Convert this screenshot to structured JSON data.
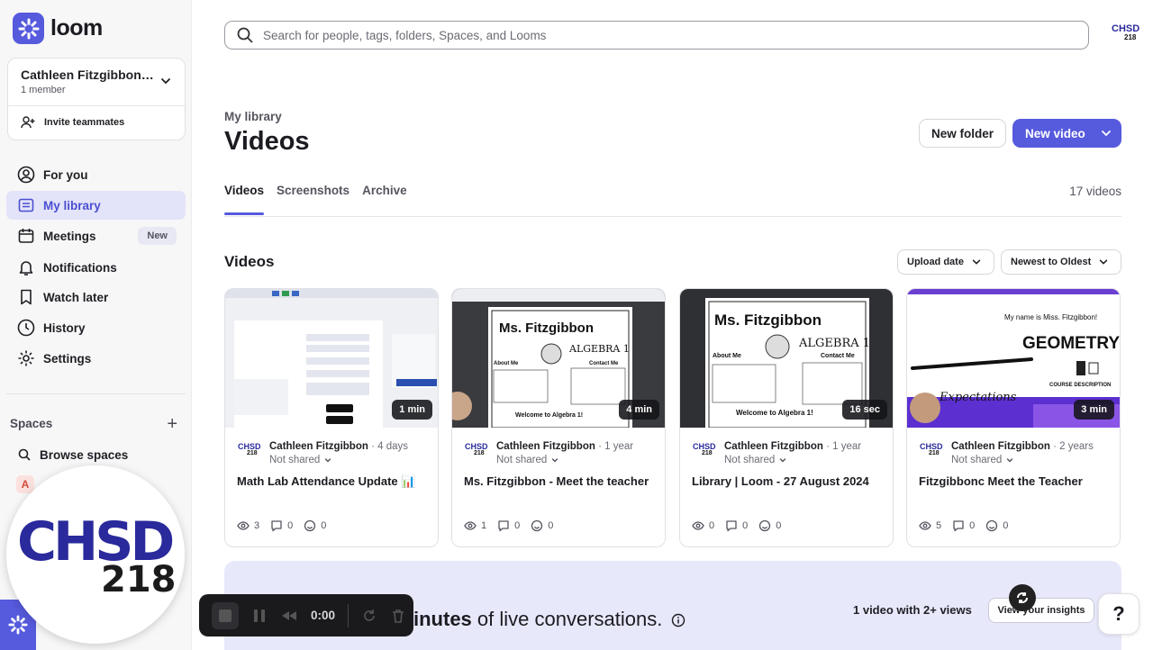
{
  "app": {
    "brand": "loom",
    "accent": "#565add"
  },
  "workspace": {
    "name": "Cathleen Fitzgibbon's Workspace",
    "members": "1 member",
    "invite_label": "Invite teammates"
  },
  "nav": {
    "for_you": "For you",
    "my_library": "My library",
    "meetings": "Meetings",
    "meetings_badge": "New",
    "notifications": "Notifications",
    "watch_later": "Watch later",
    "history": "History",
    "settings": "Settings"
  },
  "spaces": {
    "title": "Spaces",
    "browse": "Browse spaces",
    "space_initial": "A"
  },
  "search": {
    "placeholder": "Search for people, tags, folders, Spaces, and Looms"
  },
  "avatar": {
    "line1": "CHSD",
    "line2": "218"
  },
  "header": {
    "breadcrumb": "My library",
    "title": "Videos",
    "new_folder": "New folder",
    "new_video": "New video"
  },
  "tabs": {
    "videos": "Videos",
    "screenshots": "Screenshots",
    "archive": "Archive",
    "count": "17 videos"
  },
  "section": {
    "title": "Videos",
    "sort_field": "Upload date",
    "sort_order": "Newest to Oldest"
  },
  "videos": [
    {
      "duration": "1 min",
      "author": "Cathleen Fitzgibbon",
      "ago": "4 days",
      "share": "Not shared",
      "title": "Math Lab Attendance Update 📊",
      "views": "3",
      "comments": "0",
      "reactions": "0"
    },
    {
      "duration": "4 min",
      "author": "Cathleen Fitzgibbon",
      "ago": "1 year",
      "share": "Not shared",
      "title": "Ms. Fitzgibbon - Meet the teacher",
      "views": "1",
      "comments": "0",
      "reactions": "0"
    },
    {
      "duration": "16 sec",
      "author": "Cathleen Fitzgibbon",
      "ago": "1 year",
      "share": "Not shared",
      "title": "Library | Loom - 27 August 2024",
      "views": "0",
      "comments": "0",
      "reactions": "0"
    },
    {
      "duration": "3 min",
      "author": "Cathleen Fitzgibbon",
      "ago": "2 years",
      "share": "Not shared",
      "title": "Fitzgibbonc Meet the Teacher",
      "views": "5",
      "comments": "0",
      "reactions": "0"
    }
  ],
  "thumbs": {
    "t2_name": "Ms. Fitzgibbon",
    "t2_subject": "ALGEBRA 1",
    "t2_about": "About Me",
    "t2_contact": "Contact Me",
    "t2_welcome": "Welcome to Algebra 1!",
    "t4_name": "My name is Miss. Fitzgibbon!",
    "t4_subject": "GEOMETRY",
    "t4_expect": "Expectations",
    "t4_desc": "COURSE DESCRIPTION"
  },
  "promo": {
    "text_bold": "inutes",
    "text_rest": " of live conversations.",
    "views": "1 video with 2+ views",
    "button": "View your insights"
  },
  "recorder": {
    "time": "0:00"
  },
  "help": {
    "label": "?"
  }
}
